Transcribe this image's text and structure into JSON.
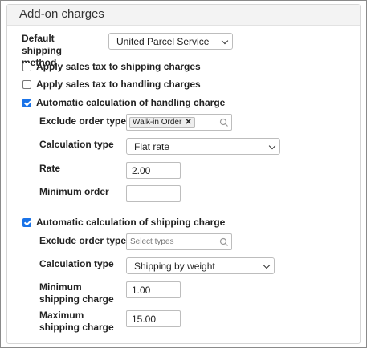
{
  "panel": {
    "title": "Add-on charges"
  },
  "default_shipping": {
    "label": "Default shipping method",
    "value": "United Parcel Service"
  },
  "checkboxes": {
    "sales_tax_shipping": {
      "label": "Apply sales tax to shipping charges",
      "checked": false
    },
    "sales_tax_handling": {
      "label": "Apply sales tax to handling charges",
      "checked": false
    },
    "auto_handling": {
      "label": "Automatic calculation of handling charge",
      "checked": true
    },
    "auto_shipping": {
      "label": "Automatic calculation of shipping charge",
      "checked": true
    }
  },
  "handling": {
    "exclude_label": "Exclude order types",
    "exclude_tags": [
      "Walk-in Order"
    ],
    "calc_type_label": "Calculation type",
    "calc_type_value": "Flat rate",
    "rate_label": "Rate",
    "rate_value": "2.00",
    "min_order_label": "Minimum order",
    "min_order_value": ""
  },
  "shipping": {
    "exclude_label": "Exclude order types",
    "exclude_placeholder": "Select types",
    "calc_type_label": "Calculation type",
    "calc_type_value": "Shipping by weight",
    "min_charge_label": "Minimum shipping charge",
    "min_charge_value": "1.00",
    "max_charge_label": "Maximum shipping charge",
    "max_charge_value": "15.00"
  },
  "colors": {
    "accent": "#1a73e8",
    "header_bg": "#f3f3f3",
    "border": "#bdbdbd"
  }
}
